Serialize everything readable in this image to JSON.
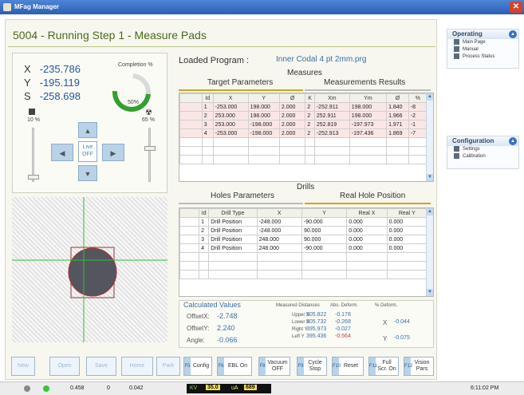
{
  "window": {
    "title": "MFag Manager",
    "close_label": "✕"
  },
  "header": {
    "title": "5004 - Running Step 1 - Measure Pads"
  },
  "position": {
    "x_label": "X",
    "x_value": "-235.786",
    "y_label": "Y",
    "y_value": "-195.119",
    "s_label": "S",
    "s_value": "-258.698",
    "completion_label": "Completion %",
    "completion_value": "50%",
    "completion_fraction": 0.5,
    "left_pct": "10 %",
    "right_pct": "65 %",
    "live_label_1": "Live",
    "live_label_2": "OFF"
  },
  "program": {
    "label": "Loaded Program :",
    "name": "Inner Codal 4 pt 2mm.prg"
  },
  "measures": {
    "title": "Measures",
    "left_tab": "Target Parameters",
    "right_tab": "Measurements Results",
    "columns": [
      "Id",
      "X",
      "Y",
      "Ø",
      "K",
      "Xm",
      "Ym",
      "Ø",
      "%"
    ],
    "rows": [
      [
        "1",
        "-253.000",
        "198.000",
        "2.000",
        "2",
        "-252.911",
        "198.000",
        "1.840",
        "-8"
      ],
      [
        "2",
        "253.000",
        "198.000",
        "2.000",
        "2",
        "252.911",
        "198.000",
        "1.966",
        "-2"
      ],
      [
        "3",
        "253.000",
        "-198.000",
        "2.000",
        "2",
        "252.819",
        "-197.973",
        "1.971",
        "-1"
      ],
      [
        "4",
        "-253.000",
        "-198.000",
        "2.000",
        "2",
        "-252.913",
        "-197.436",
        "1.869",
        "-7"
      ]
    ]
  },
  "drills": {
    "title": "Drills",
    "left_tab": "Holes Parameters",
    "right_tab": "Real Hole Position",
    "columns": [
      "Id",
      "Drill Type",
      "X",
      "Y",
      "Real X",
      "Real Y"
    ],
    "rows": [
      [
        "1",
        "Drill Position",
        "-248.000",
        "-90.000",
        "0.000",
        "0.000"
      ],
      [
        "2",
        "Drill Position",
        "-248.000",
        "90.000",
        "0.000",
        "0.000"
      ],
      [
        "3",
        "Drill Position",
        "248.000",
        "90.000",
        "0.000",
        "0.000"
      ],
      [
        "4",
        "Drill Position",
        "248.000",
        "-90.000",
        "0.000",
        "0.000"
      ]
    ]
  },
  "calculated": {
    "title": "Calculated Values",
    "offset_x_label": "OffsetX:",
    "offset_x_value": "-2.748",
    "offset_y_label": "OffsetY:",
    "offset_y_value": "2.240",
    "angle_label": "Angle:",
    "angle_value": "-0.066",
    "measured_distances_label": "Measured Distances",
    "abs_deform_label": "Abs. Deform.",
    "pct_deform_label": "% Deform.",
    "upper_x_label": "Upper X",
    "upper_x_value": "505.822",
    "upper_x_abs": "-0.178",
    "lower_x_label": "Lower X",
    "lower_x_value": "505.732",
    "lower_x_abs": "-0.268",
    "right_y_label": "Right Y",
    "right_y_value": "395.973",
    "right_y_abs": "-0.027",
    "left_y_label": "Left Y",
    "left_y_value": "395.436",
    "left_y_abs": "-0.564",
    "x_label": "X",
    "x_pct": "-0.044",
    "y_label": "Y",
    "y_pct": "-0.075"
  },
  "buttons": {
    "new": "New",
    "open": "Open",
    "save": "Save",
    "home": "Home",
    "park": "Park",
    "config": "Config",
    "config_key": "F5",
    "ebl": "EBL On",
    "ebl_key": "F6",
    "vacuum": "Vacuum OFF",
    "vacuum_key": "F8",
    "cycle": "Cycle Stop",
    "cycle_key": "F9",
    "reset": "Reset",
    "reset_key": "F10",
    "fullscr": "Full Scr. On",
    "fullscr_key": "F11",
    "vision": "Vision Pars",
    "vision_key": "F12"
  },
  "status": {
    "val1": "0.458",
    "val2": "0",
    "val3": "0.042",
    "kv_label": "KV",
    "kv_value": "35.0",
    "ua_label": "uA",
    "ua_value": "689",
    "time": "6:11:02 PM"
  },
  "sidebar": {
    "operating_title": "Operating",
    "operating_items": [
      "Main Page",
      "Manual",
      "Process Status"
    ],
    "config_title": "Configuration",
    "config_items": [
      "Settings",
      "Calibration"
    ]
  },
  "colors": {
    "accent": "#2ea22e",
    "title": "#4a6b16",
    "value_blue": "#27579a"
  }
}
